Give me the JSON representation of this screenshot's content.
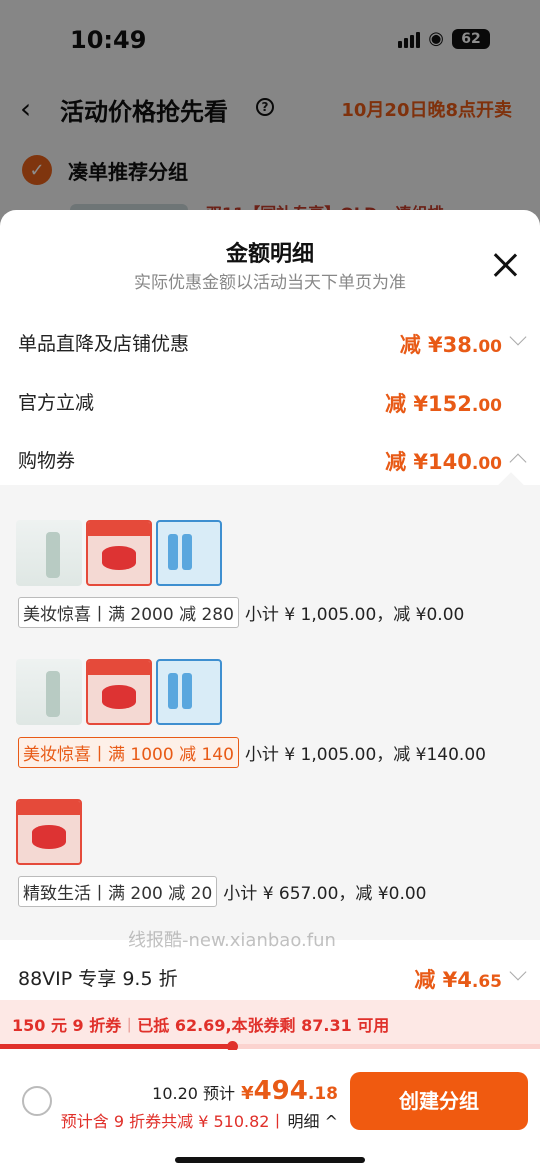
{
  "status_bar": {
    "time": "10:49",
    "battery": "62"
  },
  "background_page": {
    "back": "‹",
    "title": "活动价格抢先看",
    "help": "?",
    "sale_time": "10月20日晚8点开卖",
    "group_label": "凑单推荐分组",
    "item_snippet": "双11【国补专享】OLD...凑组排..."
  },
  "sheet": {
    "title": "金额明细",
    "subtitle": "实际优惠金额以活动当天下单页为准",
    "rows": [
      {
        "label": "单品直降及店铺优惠",
        "prefix": "减 ¥",
        "int": "38",
        "dec": ".00",
        "arrow": "down"
      },
      {
        "label": "官方立减",
        "prefix": "减 ¥",
        "int": "152",
        "dec": ".00",
        "arrow": "none"
      },
      {
        "label": "购物券",
        "prefix": "减 ¥",
        "int": "140",
        "dec": ".00",
        "arrow": "up"
      }
    ],
    "coupons": [
      {
        "tag": "美妆惊喜丨满 2000 减 280",
        "subtotal": "小计 ¥ 1,005.00，减 ¥0.00",
        "active": false,
        "thumbs": [
          "t1",
          "t2",
          "t3"
        ]
      },
      {
        "tag": "美妆惊喜丨满 1000 减 140",
        "subtotal": "小计 ¥ 1,005.00，减 ¥140.00",
        "active": true,
        "thumbs": [
          "t1",
          "t2",
          "t3"
        ]
      },
      {
        "tag": "精致生活丨满 200 减 20",
        "subtotal": "小计 ¥ 657.00，减 ¥0.00",
        "active": false,
        "thumbs": [
          "t2"
        ]
      }
    ],
    "watermark": "线报酷-new.xianbao.fun",
    "vip": {
      "label": "88VIP 专享 9.5 折",
      "prefix": "减 ¥",
      "int": "4",
      "dec": ".65"
    }
  },
  "promo": {
    "coupon": "150 元 9 折券",
    "separator": "丨",
    "status": "已抵 62.69,本张券剩 87.31 可用",
    "progress": 0.43
  },
  "checkout": {
    "estimate_label": "10.20 预计",
    "yen": "¥",
    "price_int": "494",
    "price_dec": ".18",
    "discount_note": "预计含 9 折券共减 ¥ 510.82丨",
    "detail_link": "明细 ^",
    "cta": "创建分组"
  },
  "colors": {
    "accent": "#e85a16",
    "promo_red": "#e0302a",
    "cta": "#f05a10"
  }
}
